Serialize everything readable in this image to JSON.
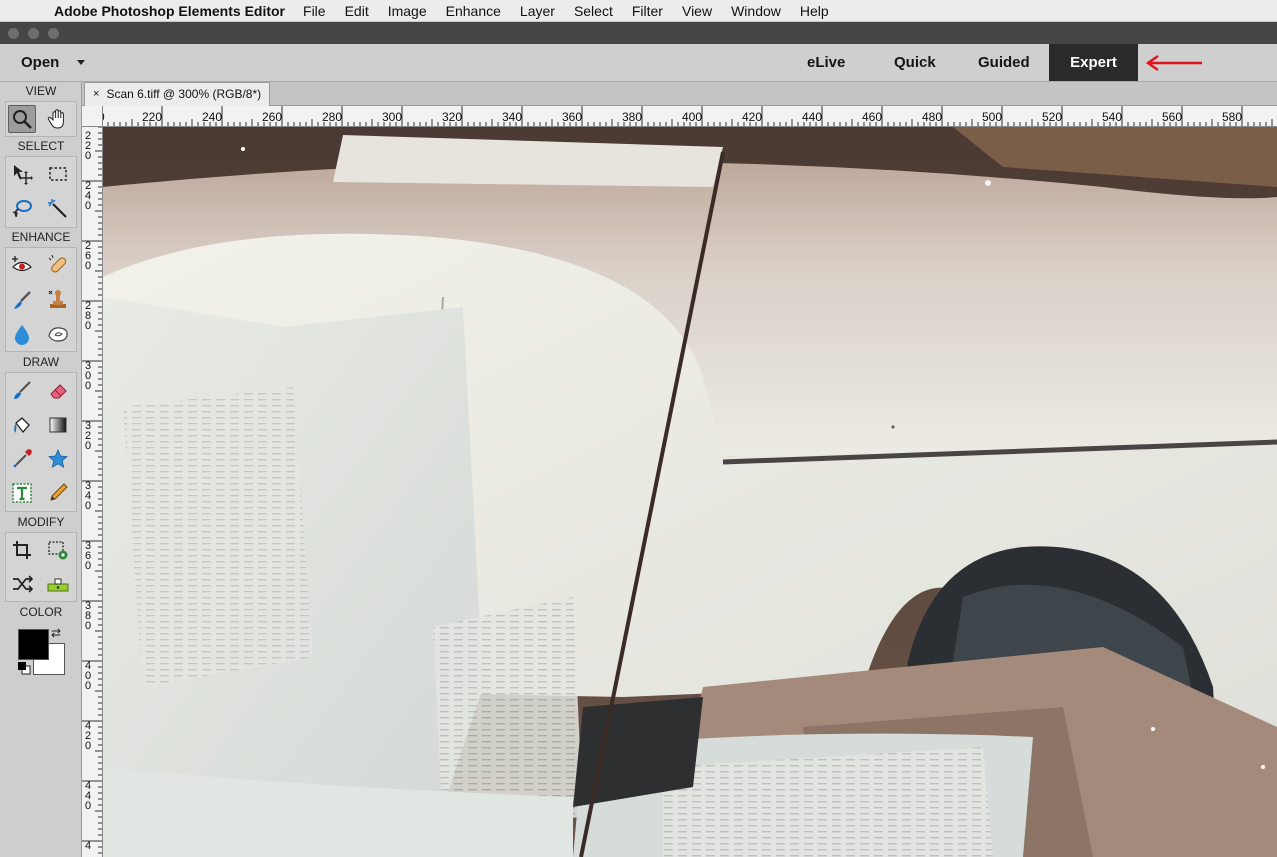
{
  "menubar": {
    "apple_icon": "apple-icon",
    "app_name": "Adobe Photoshop Elements Editor",
    "items": [
      "File",
      "Edit",
      "Image",
      "Enhance",
      "Layer",
      "Select",
      "Filter",
      "View",
      "Window",
      "Help"
    ]
  },
  "modebar": {
    "open_label": "Open",
    "modes": {
      "elive": "eLive",
      "quick": "Quick",
      "guided": "Guided",
      "expert": "Expert"
    },
    "active_mode": "Expert",
    "annotation_arrow_color": "#e0141c"
  },
  "toolbox": {
    "sections": {
      "view": "VIEW",
      "select": "SELECT",
      "enhance": "ENHANCE",
      "draw": "DRAW",
      "modify": "MODIFY",
      "color": "COLOR"
    },
    "active_tool": "zoom",
    "foreground_color": "#000000",
    "background_color": "#ffffff"
  },
  "document": {
    "tab_title": "Scan 6.tiff @ 300% (RGB/8*)",
    "close_glyph": "×"
  },
  "rulers": {
    "horizontal": [
      "0",
      "220",
      "240",
      "260",
      "280",
      "300",
      "320",
      "340",
      "360",
      "380",
      "400",
      "420",
      "440",
      "460",
      "480",
      "500",
      "520",
      "540",
      "560",
      "580"
    ],
    "vertical": [
      "2\n2\n0",
      "2\n4\n0",
      "2\n6\n0",
      "2\n8\n0",
      "3\n0\n0",
      "3\n2\n0",
      "3\n4\n0",
      "3\n6\n0",
      "3\n8\n0",
      "4\n0\n0",
      "4\n2\n0",
      "4\n4\n0",
      "4"
    ]
  },
  "colors": {
    "accent_active_mode": "#2a2a2a",
    "chrome_dark": "#454545"
  }
}
